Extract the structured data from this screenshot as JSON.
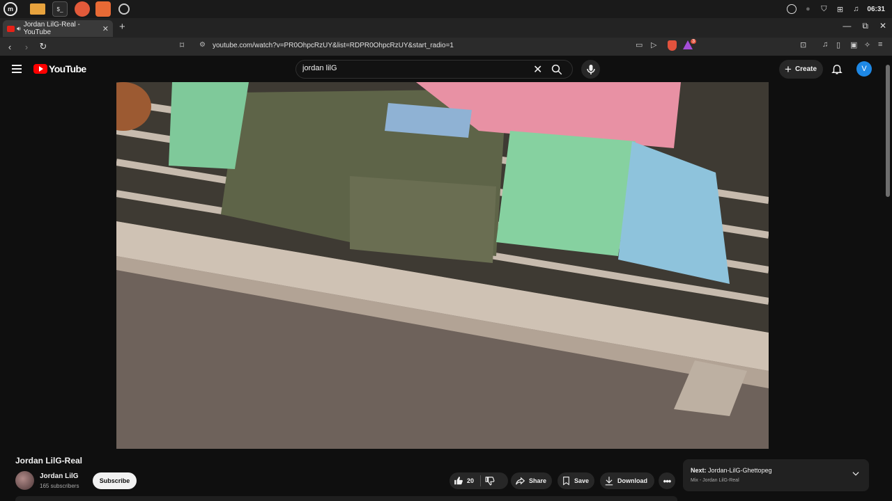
{
  "taskbar": {
    "apps": [
      "mint-menu-icon",
      "files-icon",
      "terminal-icon",
      "firefox-icon",
      "brave-icon",
      "other-icon"
    ],
    "clock": "06:31"
  },
  "browser": {
    "tab_title": "Jordan LilG-Real - YouTube",
    "url": "youtube.com/watch?v=PR0OhpcRzUY&list=RDPR0OhpcRzUY&start_radio=1",
    "shield_badge": "3"
  },
  "youtube": {
    "logo_text": "YouTube",
    "search_value": "jordan lilG",
    "create_label": "Create",
    "avatar_letter": "V"
  },
  "video": {
    "title": "Jordan LilG-Real",
    "channel_name": "Jordan LilG",
    "subscribers": "165 subscribers",
    "subscribe_label": "Subscribe",
    "like_count": "20",
    "share_label": "Share",
    "save_label": "Save",
    "download_label": "Download"
  },
  "next": {
    "prefix": "Next:",
    "title": "Jordan-LilG-Ghettopeg",
    "subtitle": "Mix - Jordan LilG-Real"
  },
  "colors": {
    "yt_red": "#ff0000",
    "background": "#0f0f0f",
    "avatar_blue": "#1e88e5"
  }
}
